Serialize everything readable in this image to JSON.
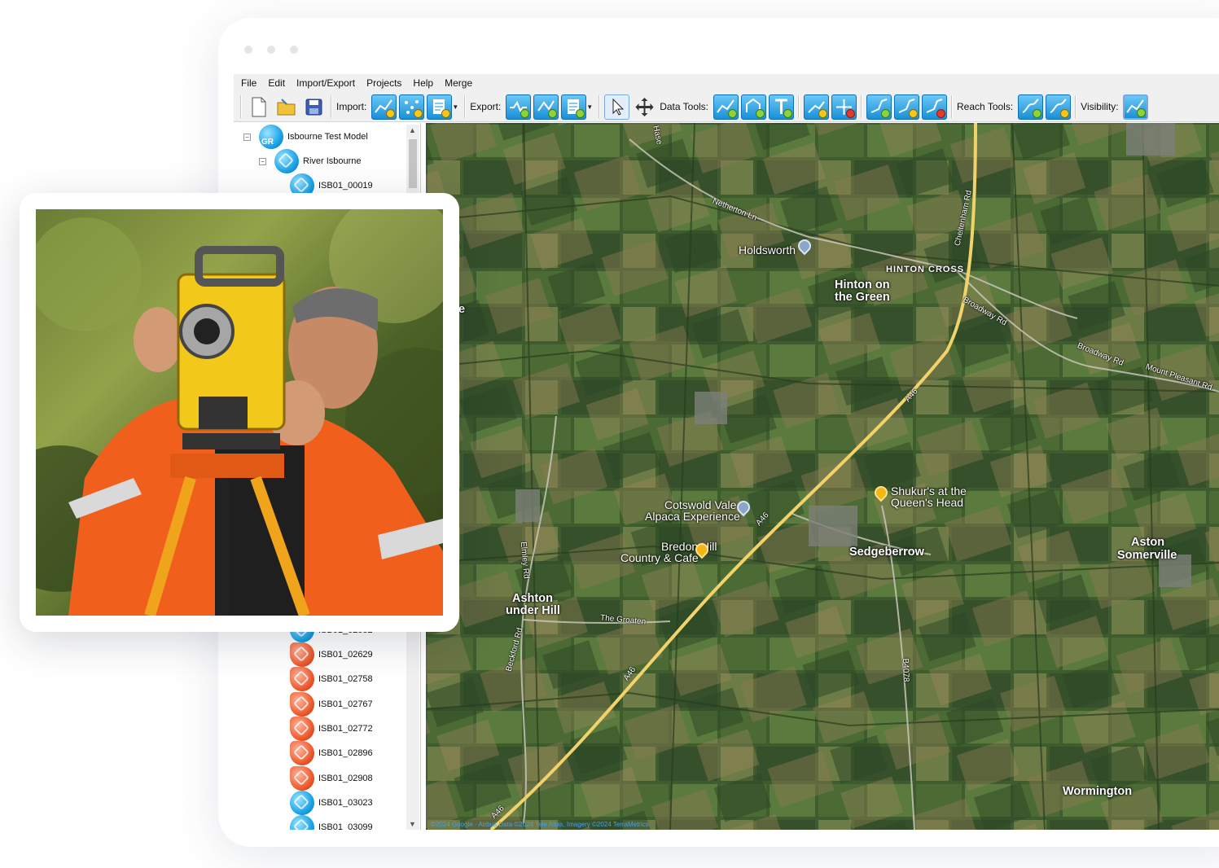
{
  "menu": [
    "File",
    "Edit",
    "Import/Export",
    "Projects",
    "Help",
    "Merge"
  ],
  "toolbar": {
    "import_label": "Import:",
    "export_label": "Export:",
    "data_tools_label": "Data Tools:",
    "reach_tools_label": "Reach Tools:",
    "visibility_label": "Visibility:"
  },
  "tree": {
    "root": "Isbourne Test Model",
    "root_icon_text": "GR",
    "reach": "River Isbourne",
    "top_items": [
      "ISB01_00019"
    ],
    "partial_item": "ISB01_02582",
    "items": [
      {
        "label": "ISB01_02629",
        "color": "red"
      },
      {
        "label": "ISB01_02758",
        "color": "red"
      },
      {
        "label": "ISB01_02767",
        "color": "red"
      },
      {
        "label": "ISB01_02772",
        "color": "red"
      },
      {
        "label": "ISB01_02896",
        "color": "red"
      },
      {
        "label": "ISB01_02908",
        "color": "red"
      },
      {
        "label": "ISB01_03023",
        "color": "blue"
      },
      {
        "label": "ISB01_03099",
        "color": "blue"
      }
    ]
  },
  "map": {
    "places": {
      "holdsworth": "Holdsworth",
      "hinton_cross": "HINTON CROSS",
      "hinton_green_1": "Hinton on",
      "hinton_green_2": "the Green",
      "cotswold_1": "Cotswold Vale",
      "cotswold_2": "Alpaca Experience",
      "shukur_1": "Shukur's at the",
      "shukur_2": "Queen's Head",
      "bredon_1": "Bredon Hill",
      "bredon_2": "Country & Cafe",
      "sedgeberrow": "Sedgeberrow",
      "ashton_1": "Ashton",
      "ashton_2": "under Hill",
      "aston_1": "Aston",
      "aston_2": "Somerville",
      "wormington": "Wormington",
      "edge_e": "e"
    },
    "roads": {
      "netherton": "Netherton Ln",
      "cheltenham": "Cheltenham Rd",
      "broadway1": "Broadway Rd",
      "broadway2": "Broadway Rd",
      "mount_pleasant": "Mount Pleasant Rd",
      "a46_1": "A46",
      "a46_2": "A46",
      "a46_3": "A46",
      "a46_4": "A46",
      "elmley": "Elmley Rd",
      "beckford": "Beckford Rd",
      "groaten": "The Groaten",
      "b4078": "B4078",
      "hase": "Hase"
    },
    "copyright": "©2024 Google · Airbus Data ©2024 Tele Atlas, Imagery ©2024 TerraMetrics"
  },
  "colors": {
    "toolbar_bg": "#f0f0f0",
    "icon_blue": "#1a8fd8",
    "node_red": "#ef5b2d",
    "road_yellow": "#f2d36b"
  }
}
